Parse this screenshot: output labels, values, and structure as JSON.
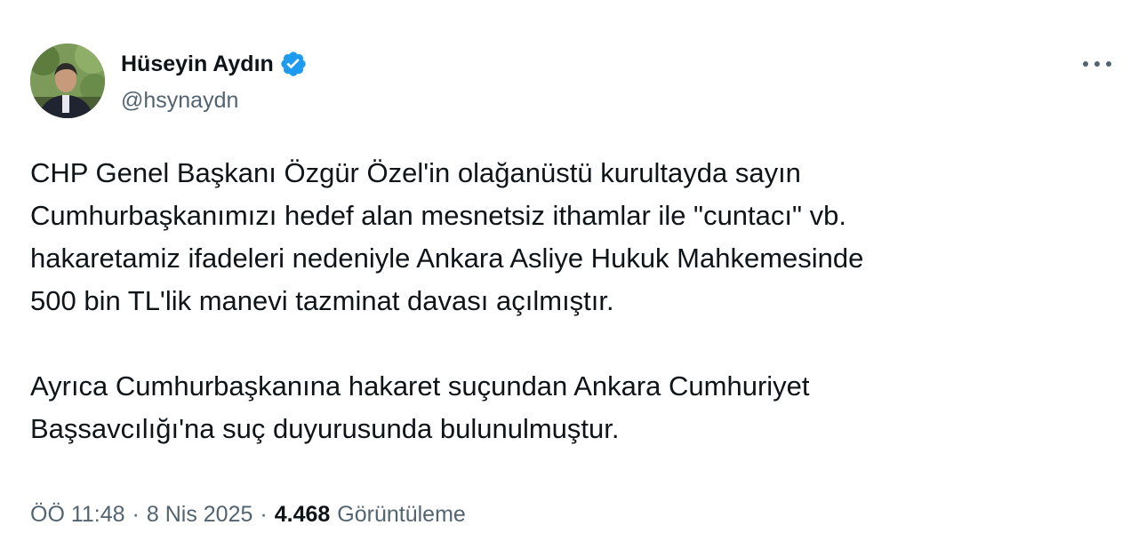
{
  "cut_header": "...",
  "author": {
    "display_name": "Hüseyin Aydın",
    "handle": "@hsynaydn",
    "verified_icon": "verified-badge-icon",
    "accent_color": "#1d9bf0"
  },
  "menu": {
    "more_icon": "more-horizontal-icon"
  },
  "tweet": {
    "lines_para1": [
      "CHP Genel Başkanı Özgür Özel'in olağanüstü kurultayda sayın",
      "Cumhurbaşkanımızı hedef alan mesnetsiz ithamlar ile \"cuntacı\" vb.",
      "hakaretamiz ifadeleri nedeniyle Ankara Asliye Hukuk Mahkemesinde",
      "500 bin TL'lik manevi tazminat davası açılmıştır."
    ],
    "lines_para2": [
      "Ayrıca Cumhurbaşkanına hakaret suçundan Ankara Cumhuriyet",
      "Başsavcılığı'na suç duyurusunda bulunulmuştur."
    ]
  },
  "meta": {
    "time": "ÖÖ 11:48",
    "separator": "·",
    "date": "8 Nis 2025",
    "views_count": "4.468",
    "views_label": "Görüntüleme"
  }
}
